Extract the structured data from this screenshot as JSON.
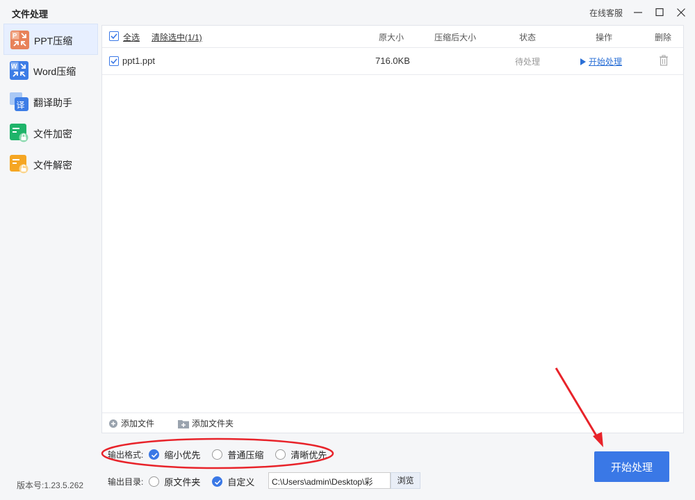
{
  "app": {
    "title": "文件处理",
    "customer_service": "在线客服",
    "version": "版本号:1.23.5.262"
  },
  "sidebar": {
    "items": [
      {
        "label": "PPT压缩",
        "icon": "ppt-compress-icon",
        "active": true
      },
      {
        "label": "Word压缩",
        "icon": "word-compress-icon",
        "active": false
      },
      {
        "label": "翻译助手",
        "icon": "translate-icon",
        "active": false
      },
      {
        "label": "文件加密",
        "icon": "file-encrypt-icon",
        "active": false
      },
      {
        "label": "文件解密",
        "icon": "file-decrypt-icon",
        "active": false
      }
    ]
  },
  "table": {
    "select_all": "全选",
    "clear_selected": "清除选中(1/1)",
    "columns": {
      "original_size": "原大小",
      "compressed_size": "压缩后大小",
      "status": "状态",
      "action": "操作",
      "delete": "删除"
    },
    "rows": [
      {
        "name": "ppt1.ppt",
        "original_size": "716.0KB",
        "compressed_size": "",
        "status": "待处理",
        "action": "开始处理",
        "checked": true
      }
    ]
  },
  "footer": {
    "add_file": "添加文件",
    "add_folder": "添加文件夹"
  },
  "options": {
    "format_label": "输出格式:",
    "format_choices": [
      "缩小优先",
      "普通压缩",
      "清晰优先"
    ],
    "format_selected": "缩小优先",
    "dir_label": "输出目录:",
    "dir_choices": [
      "原文件夹",
      "自定义"
    ],
    "dir_selected": "自定义",
    "path": "C:\\Users\\admin\\Desktop\\彩",
    "browse": "浏览"
  },
  "start_button": "开始处理",
  "colors": {
    "accent": "#3a78e6",
    "annotation": "#e8232a",
    "sidebar_active": "#e7efff"
  }
}
